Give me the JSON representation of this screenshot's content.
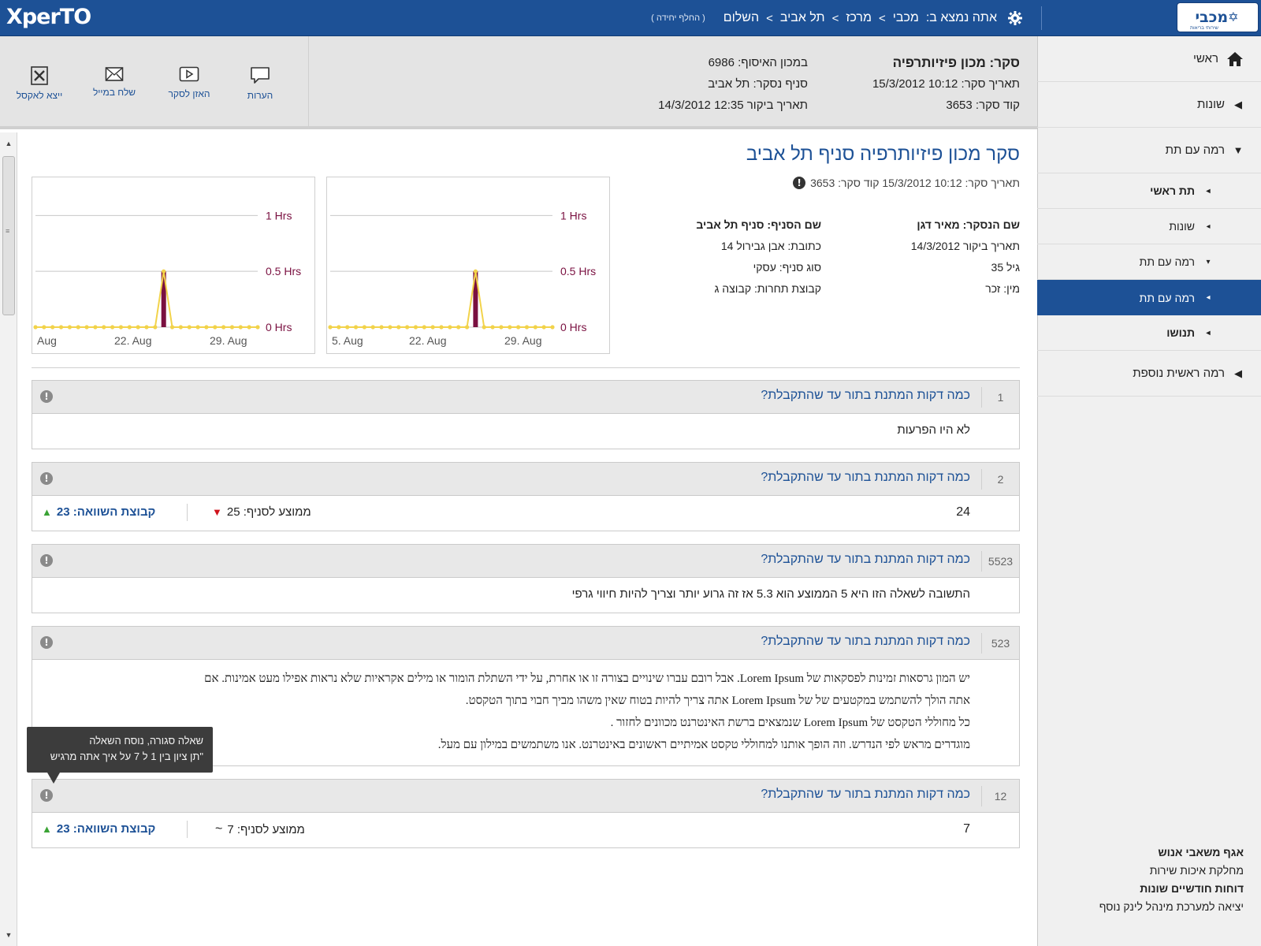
{
  "app": {
    "logo": "XperTO"
  },
  "brand": {
    "name": "מכבי",
    "star": "✡",
    "sub": "שירותי בריאות"
  },
  "breadcrumb": {
    "prefix": "אתה נמצא ב:",
    "items": [
      "מכבי",
      "מרכז",
      "תל אביב",
      "השלום"
    ],
    "sep": ">",
    "switch_link": "( החלף יחידה )"
  },
  "sidebar": {
    "items": [
      {
        "label": "ראשי",
        "icon": "home-icon"
      },
      {
        "label": "שונות",
        "tri": "◀"
      },
      {
        "label": "רמה עם תת",
        "tri": "▼"
      },
      {
        "label": "תת ראשי",
        "tri": "◂"
      },
      {
        "label": "שונות",
        "tri": "◂"
      },
      {
        "label": "רמה עם תת",
        "tri": "▾"
      },
      {
        "label": "רמה עם תת",
        "tri": "◂"
      },
      {
        "label": "תנושו",
        "tri": "◂"
      },
      {
        "label": "רמה ראשית נוספת",
        "tri": "◀"
      }
    ],
    "footer": {
      "line1": "אגף משאבי אנוש",
      "line2": "מחלקת איכות שירות",
      "line3": "דוחות חודשיים שונות",
      "line4": "יציאה למערכת מינהל לינק נוסף"
    }
  },
  "toolbar": {
    "comments": "הערות",
    "listen": "האזן לסקר",
    "send_mail": "שלח במייל",
    "export_excel": "ייצא לאקסל"
  },
  "header_meta": {
    "survey_label": "סקר: מכון פיזיותרפיה",
    "survey_date": "תאריך סקר: 10:12 15/3/2012",
    "survey_code": "קוד סקר: 3653",
    "collection_point": "במכון האיסוף: 6986",
    "branch": "סניף נסקר: תל אביב",
    "visit_date": "תאריך ביקור 12:35 14/3/2012"
  },
  "survey": {
    "title": "סקר מכון פיזיותרפיה סניף תל אביב",
    "subtitle": "תאריך סקר: 10:12 15/3/2012   קוד סקר: 3653"
  },
  "info": {
    "surveyed_name": "שם הנסקר: מאיר דגן",
    "visit_date": "תאריך ביקור 14/3/2012",
    "age": "גיל 35",
    "gender": "מין: זכר",
    "branch_name": "שם הסניף: סניף תל אביב",
    "address": "כתובת: אבן גבירול 14",
    "branch_type": "סוג סניף: עסקי",
    "competition_group": "קבוצת תחרות: קבוצה ג"
  },
  "chart_data": [
    {
      "type": "line",
      "y_tick_labels": [
        "0 Hrs",
        "0.5 Hrs",
        "1 Hrs"
      ],
      "ylim": [
        0,
        1.2
      ],
      "x_tick_labels": [
        "Aug",
        "22. Aug",
        "29. Aug"
      ],
      "grid": true,
      "series": [
        {
          "values": [
            0,
            0,
            0,
            0,
            0,
            0,
            0,
            0,
            0,
            0,
            0,
            0,
            0,
            0,
            0,
            0.5,
            0,
            0,
            0,
            0,
            0,
            0,
            0,
            0,
            0,
            0,
            0
          ],
          "color": "#f2d34b"
        }
      ],
      "bar": {
        "index": 15,
        "value": 0.5,
        "color": "#7a1040"
      }
    },
    {
      "type": "line",
      "y_tick_labels": [
        "0 Hrs",
        "0.5 Hrs",
        "1 Hrs"
      ],
      "ylim": [
        0,
        1.2
      ],
      "x_tick_labels": [
        "5. Aug",
        "22. Aug",
        "29. Aug"
      ],
      "grid": true,
      "series": [
        {
          "values": [
            0,
            0,
            0,
            0,
            0,
            0,
            0,
            0,
            0,
            0,
            0,
            0,
            0,
            0,
            0,
            0,
            0,
            0.5,
            0,
            0,
            0,
            0,
            0,
            0,
            0,
            0,
            0
          ],
          "color": "#f2d34b"
        }
      ],
      "bar": {
        "index": 17,
        "value": 0.5,
        "color": "#7a1040"
      }
    }
  ],
  "questions": [
    {
      "num": "1",
      "text": "כמה דקות המתנת בתור עד שהתקבלת?",
      "answer": "לא היו הפרעות"
    },
    {
      "num": "2",
      "text": "כמה דקות המתנת בתור עד שהתקבלת?",
      "answer": "24",
      "branch_avg": "ממוצע לסניף: 25",
      "compare": "קבוצת השוואה: 23"
    },
    {
      "num": "5523",
      "text": "כמה דקות המתנת בתור עד שהתקבלת?",
      "answer": "התשובה לשאלה הזו היא 5  הממוצע הוא 5.3 אז זה גרוע יותר וצריך להיות חיווי גרפי"
    },
    {
      "num": "523",
      "text": "כמה דקות המתנת בתור עד שהתקבלת?",
      "lines": [
        "יש המון גרסאות זמינות לפסקאות של Lorem Ipsum. אבל רובם עברו שינויים בצורה זו או אחרת, על ידי השתלת הומור או מילים אקראיות שלא נראות אפילו מעט אמינות. אם",
        "אתה הולך להשתמש במקטעים של של Lorem Ipsum אתה צריך להיות בטוח שאין משהו מביך חבוי בתוך הטקסט.",
        "כל מחוללי הטקסט של Lorem Ipsum שנמצאים ברשת האינטרנט מכוונים לחזור .",
        "מוגדרים מראש לפי הנדרש. וזה הופך אותנו למחוללי טקסט אמיתיים ראשונים באינטרנט. אנו משתמשים במילון עם מעל."
      ]
    },
    {
      "num": "12",
      "text": "כמה דקות המתנת בתור עד שהתקבלת?",
      "answer": "7",
      "branch_avg": "ממוצע לסניף: 7",
      "compare": "קבוצת השוואה: 23"
    }
  ],
  "tooltip": {
    "line1": "שאלה סגורה, נוסח השאלה",
    "line2": "\"תן ציון בין 1 ל 7 על איך אתה מרגיש"
  },
  "colors": {
    "brand": "#1d5196",
    "down": "#d0121b",
    "up": "#3aa335",
    "spike": "#7a1040",
    "line": "#f2d34b"
  }
}
